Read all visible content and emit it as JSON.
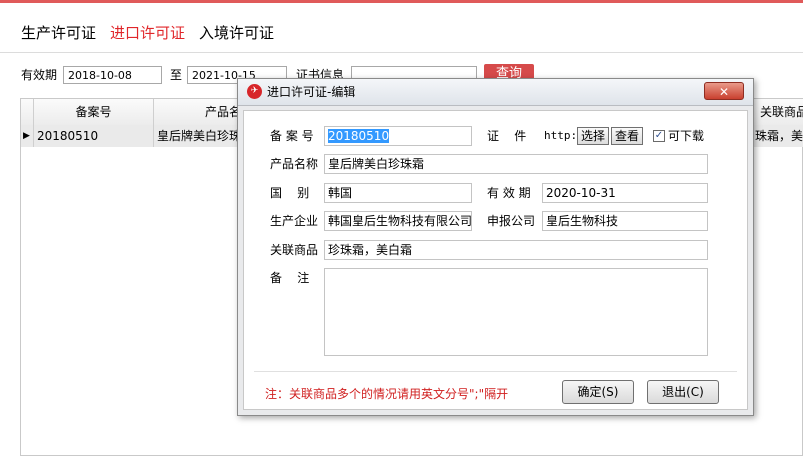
{
  "tabs": [
    {
      "label": "生产许可证"
    },
    {
      "label": "进口许可证"
    },
    {
      "label": "入境许可证"
    }
  ],
  "filter": {
    "validity_label": "有效期",
    "date_from": "2018-10-08",
    "to_label": "至",
    "date_to": "2021-10-15",
    "cert_info_label": "证书信息",
    "cert_info_value": "",
    "query_label": "查询"
  },
  "grid": {
    "columns": [
      "备案号",
      "产品名称",
      "关联商品"
    ],
    "rows": [
      {
        "pointer": "▶",
        "record_no": "20180510",
        "product": "皇后牌美白珍珠",
        "related": "珠霜，美白"
      }
    ]
  },
  "dialog": {
    "title": "进口许可证-编辑",
    "close": "✕",
    "fields": {
      "record_no_label": "备 案 号",
      "record_no": "20180510",
      "cert_label": "证    件",
      "cert_value": "http:",
      "choose_label": "选择",
      "view_label": "查看",
      "downloadable_label": "可下载",
      "downloadable_check": "✓",
      "product_name_label": "产品名称",
      "product_name": "皇后牌美白珍珠霜",
      "country_label": "国    别",
      "country": "韩国",
      "validity_label": "有 效 期",
      "validity": "2020-10-31",
      "manufacturer_label": "生产企业",
      "manufacturer": "韩国皇后生物科技有限公司",
      "applicant_label": "申报公司",
      "applicant": "皇后生物科技",
      "related_label": "关联商品",
      "related": "珍珠霜，美白霜",
      "remark_label": "备    注",
      "remark": ""
    },
    "note": "注：关联商品多个的情况请用英文分号\";\"隔开",
    "ok_label": "确定(S)",
    "exit_label": "退出(C)"
  }
}
